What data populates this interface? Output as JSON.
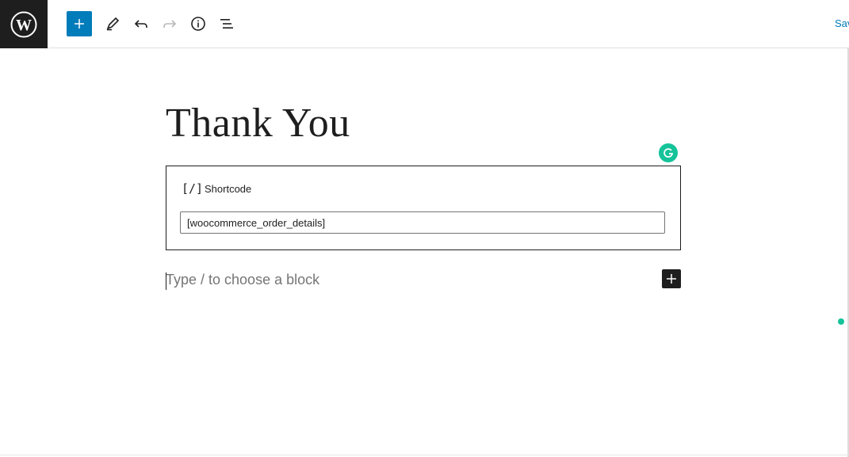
{
  "toolbar": {
    "add_block_icon": "plus-icon",
    "tools_icon": "pencil-icon",
    "undo_icon": "undo-icon",
    "redo_icon": "redo-icon",
    "details_icon": "info-icon",
    "list_view_icon": "list-view-icon",
    "save_label": "Save draft",
    "accent_color": "#007cba"
  },
  "editor": {
    "title": "Thank You",
    "shortcode_block": {
      "icon_glyph": "[/]",
      "label": "Shortcode",
      "value": "[woocommerce_order_details]"
    },
    "empty_block_placeholder": "Type / to choose a block"
  },
  "extensions": {
    "grammarly_color": "#15c39a"
  }
}
